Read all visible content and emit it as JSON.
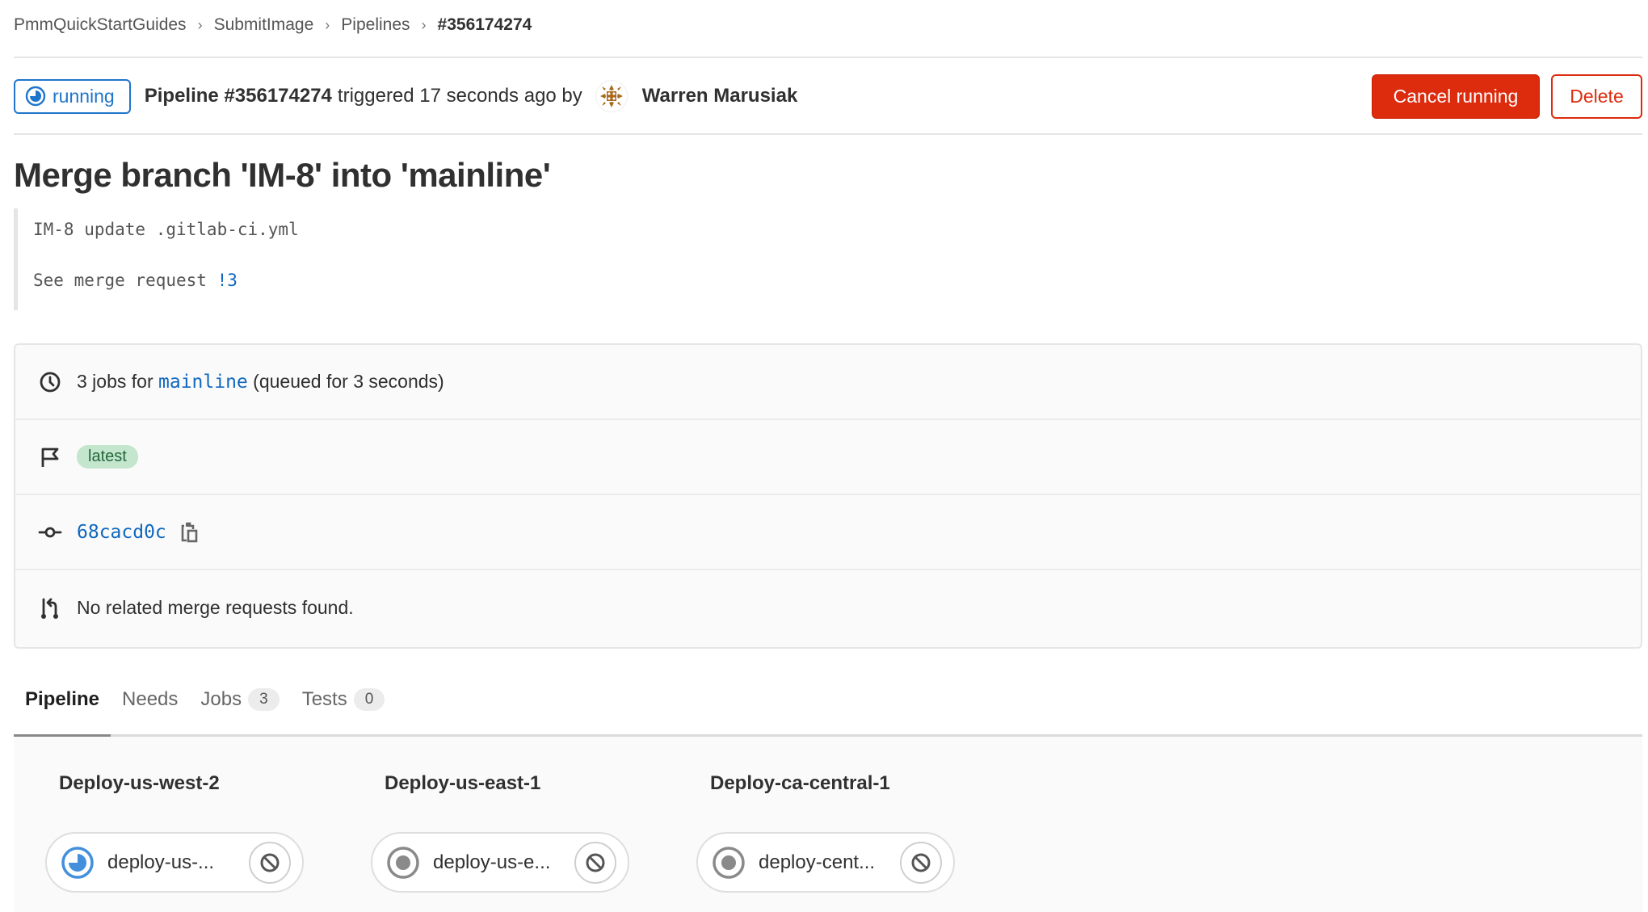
{
  "breadcrumb": [
    {
      "label": "PmmQuickStartGuides"
    },
    {
      "label": "SubmitImage"
    },
    {
      "label": "Pipelines"
    },
    {
      "label": "#356174274"
    }
  ],
  "header": {
    "status": "running",
    "pipeline_label": "Pipeline #356174274",
    "triggered_text": "triggered 17 seconds ago by",
    "author": "Warren Marusiak",
    "actions": {
      "cancel_label": "Cancel running",
      "delete_label": "Delete"
    }
  },
  "commit": {
    "title": "Merge branch 'IM-8' into 'mainline'",
    "description_line1": "IM-8 update .gitlab-ci.yml",
    "description_line2_prefix": "See merge request ",
    "merge_request_link": "!3"
  },
  "info": {
    "jobs_prefix": "3 jobs for ",
    "branch": "mainline",
    "jobs_suffix": " (queued for 3 seconds)",
    "badge": "latest",
    "sha": "68cacd0c",
    "merge_requests": "No related merge requests found."
  },
  "tabs": [
    {
      "label": "Pipeline",
      "active": true
    },
    {
      "label": "Needs"
    },
    {
      "label": "Jobs",
      "count": "3"
    },
    {
      "label": "Tests",
      "count": "0"
    }
  ],
  "stages": [
    {
      "title": "Deploy-us-west-2",
      "job": {
        "name": "deploy-us-...",
        "status": "running"
      }
    },
    {
      "title": "Deploy-us-east-1",
      "job": {
        "name": "deploy-us-e...",
        "status": "created"
      }
    },
    {
      "title": "Deploy-ca-central-1",
      "job": {
        "name": "deploy-cent...",
        "status": "created"
      }
    }
  ],
  "colors": {
    "running": "#1f75cb",
    "danger": "#dd2b0e",
    "link": "#1068bf",
    "latest_bg": "#c3e6cd",
    "latest_fg": "#24663b"
  }
}
